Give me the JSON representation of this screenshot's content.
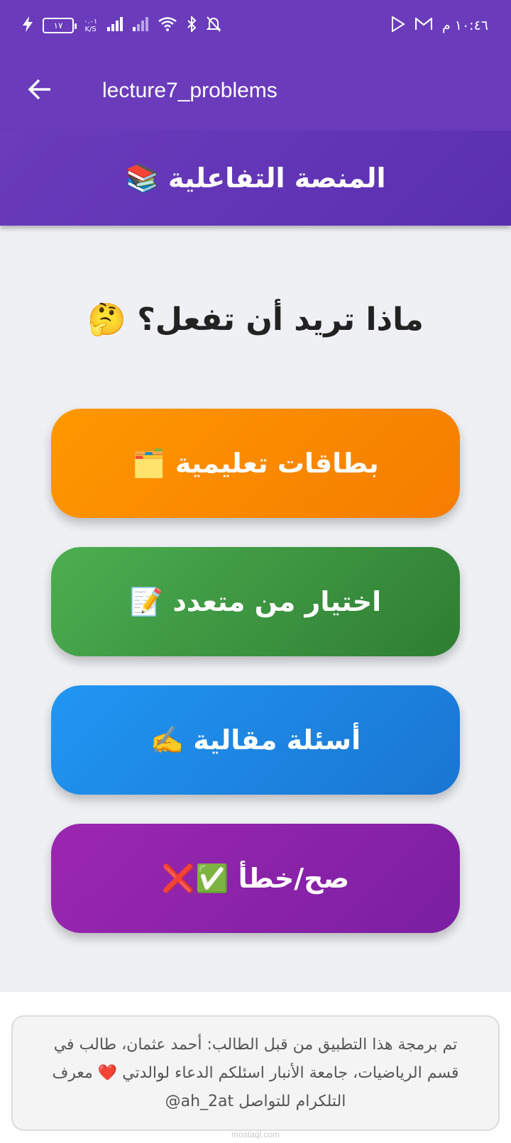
{
  "status_bar": {
    "time": "١٠:٤٦ م",
    "battery": "١٧",
    "net_speed_value": "٠.٠١",
    "net_speed_unit": "K/S"
  },
  "app_bar": {
    "title": "lecture7_problems"
  },
  "header": {
    "title": "المنصة التفاعلية 📚"
  },
  "question": "ماذا تريد أن تفعل؟ 🤔",
  "menu": {
    "flashcards": "بطاقات تعليمية 🗂️",
    "multiple_choice": "اختيار من متعدد 📝",
    "essay": "أسئلة مقالية ✍️",
    "true_false": "صح/خطأ ✅❌"
  },
  "footer": {
    "credit": "تم برمجة هذا التطبيق من قبل الطالب: أحمد عثمان، طالب في قسم الرياضيات، جامعة الأنبار اسئلكم الدعاء لوالدتي ❤️ معرف التلكرام للتواصل ah_2at@"
  },
  "watermark": "mostaql.com",
  "colors": {
    "primary": "#6a3cbc",
    "flashcards": "#fb8c00",
    "multiple_choice": "#43a047",
    "essay": "#1e88e5",
    "true_false": "#8e24aa"
  }
}
